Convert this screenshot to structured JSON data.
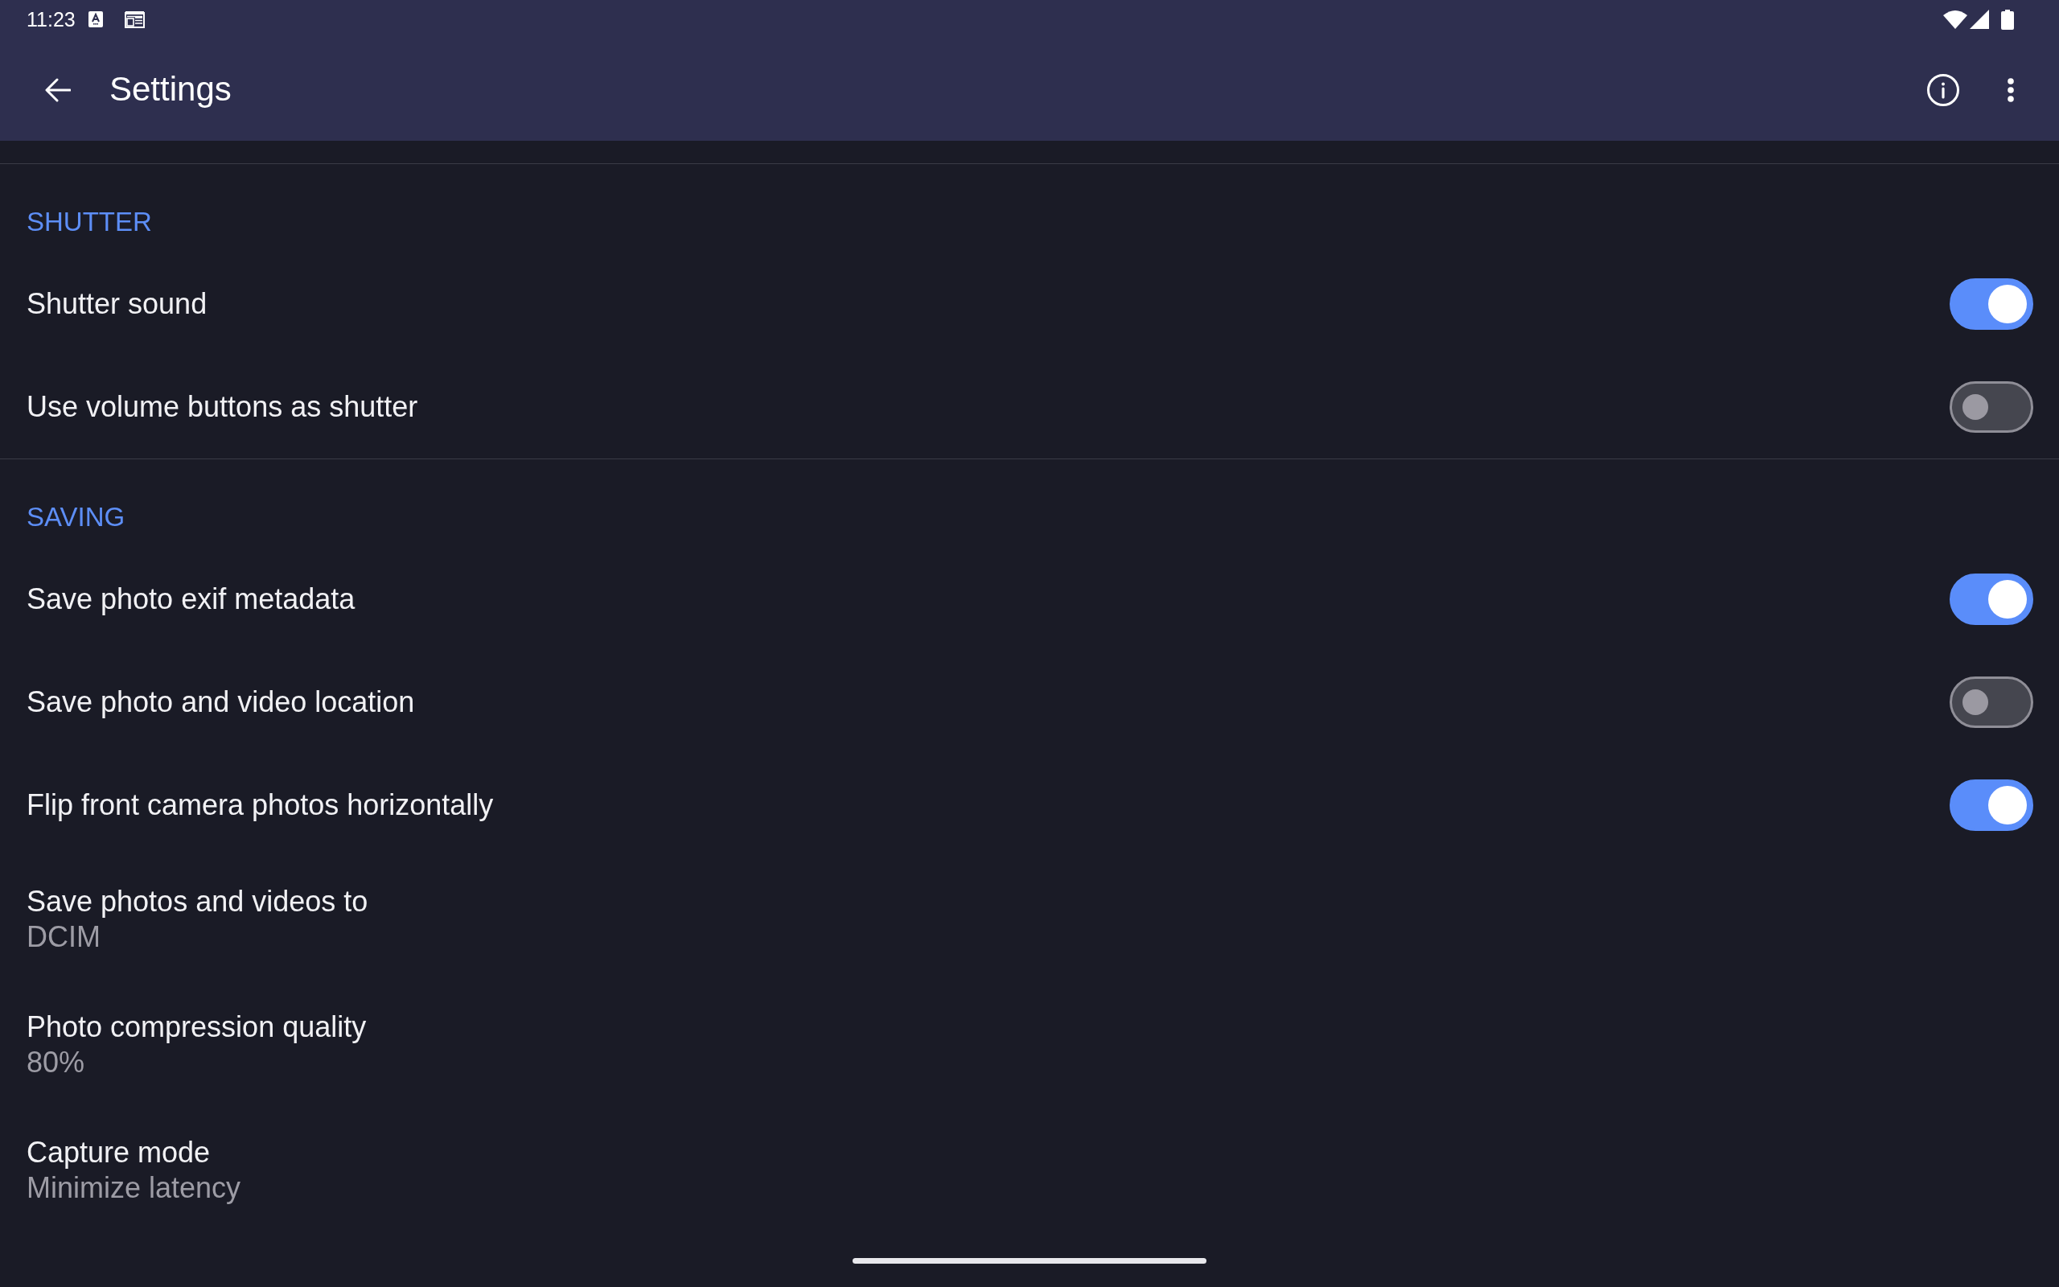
{
  "status_bar": {
    "time": "11:23"
  },
  "app_bar": {
    "title": "Settings"
  },
  "sections": [
    {
      "header": "SHUTTER",
      "items": [
        {
          "kind": "switch",
          "title": "Shutter sound",
          "on": true
        },
        {
          "kind": "switch",
          "title": "Use volume buttons as shutter",
          "on": false
        }
      ]
    },
    {
      "header": "SAVING",
      "items": [
        {
          "kind": "switch",
          "title": "Save photo exif metadata",
          "on": true
        },
        {
          "kind": "switch",
          "title": "Save photo and video location",
          "on": false
        },
        {
          "kind": "switch",
          "title": "Flip front camera photos horizontally",
          "on": true
        },
        {
          "kind": "value",
          "title": "Save photos and videos to",
          "value": "DCIM"
        },
        {
          "kind": "value",
          "title": "Photo compression quality",
          "value": "80%"
        },
        {
          "kind": "value",
          "title": "Capture mode",
          "value": "Minimize latency"
        }
      ]
    }
  ]
}
